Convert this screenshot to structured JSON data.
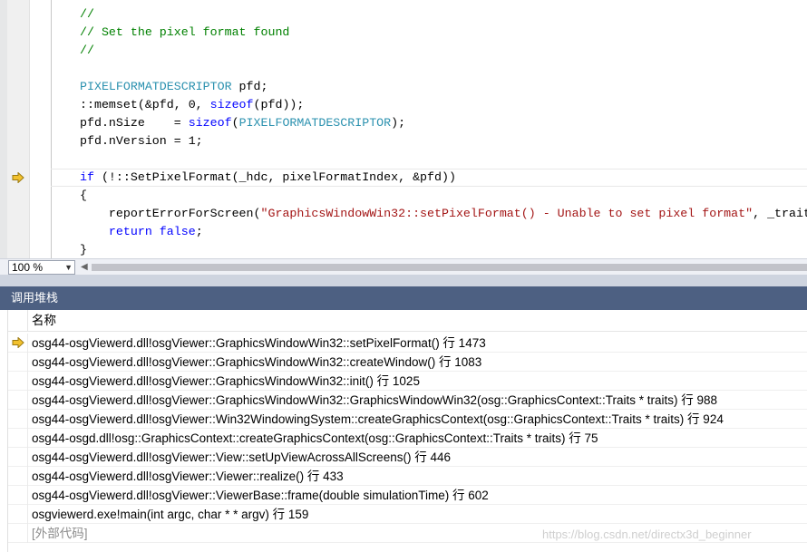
{
  "editor": {
    "lines": [
      [
        {
          "t": "//",
          "c": "cm"
        }
      ],
      [
        {
          "t": "// Set the pixel format found",
          "c": "cm"
        }
      ],
      [
        {
          "t": "//",
          "c": "cm"
        }
      ],
      [],
      [
        {
          "t": "PIXELFORMATDESCRIPTOR",
          "c": "ty"
        },
        {
          "t": " pfd;",
          "c": ""
        }
      ],
      [
        {
          "t": "::memset(&pfd, 0, ",
          "c": ""
        },
        {
          "t": "sizeof",
          "c": "kw"
        },
        {
          "t": "(pfd));",
          "c": ""
        }
      ],
      [
        {
          "t": "pfd.nSize    = ",
          "c": ""
        },
        {
          "t": "sizeof",
          "c": "kw"
        },
        {
          "t": "(",
          "c": ""
        },
        {
          "t": "PIXELFORMATDESCRIPTOR",
          "c": "ty"
        },
        {
          "t": ");",
          "c": ""
        }
      ],
      [
        {
          "t": "pfd.nVersion = 1;",
          "c": ""
        }
      ],
      [],
      [
        {
          "t": "if",
          "c": "kw"
        },
        {
          "t": " (!::SetPixelFormat(_hdc, pixelFormatIndex, &pfd))",
          "c": ""
        }
      ],
      [
        {
          "t": "{",
          "c": ""
        }
      ],
      [
        {
          "t": "    reportErrorForScreen(",
          "c": ""
        },
        {
          "t": "\"GraphicsWindowWin32::setPixelFormat() - Unable to set pixel format\"",
          "c": "str"
        },
        {
          "t": ", _traits.get(), ::GetLastError());",
          "c": ""
        }
      ],
      [
        {
          "t": "    ",
          "c": ""
        },
        {
          "t": "return",
          "c": "kw"
        },
        {
          "t": " ",
          "c": ""
        },
        {
          "t": "false",
          "c": "kw"
        },
        {
          "t": ";",
          "c": ""
        }
      ],
      [
        {
          "t": "}",
          "c": ""
        }
      ]
    ]
  },
  "zoom": {
    "value": "100 %"
  },
  "callstack": {
    "title": "调用堆栈",
    "column_name": "名称",
    "rows": [
      {
        "text": "osg44-osgViewerd.dll!osgViewer::GraphicsWindowWin32::setPixelFormat() 行 1473",
        "current": true
      },
      {
        "text": "osg44-osgViewerd.dll!osgViewer::GraphicsWindowWin32::createWindow() 行 1083",
        "current": false
      },
      {
        "text": "osg44-osgViewerd.dll!osgViewer::GraphicsWindowWin32::init() 行 1025",
        "current": false
      },
      {
        "text": "osg44-osgViewerd.dll!osgViewer::GraphicsWindowWin32::GraphicsWindowWin32(osg::GraphicsContext::Traits * traits) 行 988",
        "current": false
      },
      {
        "text": "osg44-osgViewerd.dll!osgViewer::Win32WindowingSystem::createGraphicsContext(osg::GraphicsContext::Traits * traits) 行 924",
        "current": false
      },
      {
        "text": "osg44-osgd.dll!osg::GraphicsContext::createGraphicsContext(osg::GraphicsContext::Traits * traits) 行 75",
        "current": false
      },
      {
        "text": "osg44-osgViewerd.dll!osgViewer::View::setUpViewAcrossAllScreens() 行 446",
        "current": false
      },
      {
        "text": "osg44-osgViewerd.dll!osgViewer::Viewer::realize() 行 433",
        "current": false
      },
      {
        "text": "osg44-osgViewerd.dll!osgViewer::ViewerBase::frame(double simulationTime) 行 602",
        "current": false
      },
      {
        "text": "osgviewerd.exe!main(int argc, char * * argv) 行 159",
        "current": false
      },
      {
        "text": "[外部代码]",
        "current": false,
        "external": true
      }
    ]
  },
  "watermark": "https://blog.csdn.net/directx3d_beginner",
  "colors": {
    "panel_title_bg": "#4d6082",
    "current_arrow": "#f2c12e",
    "comment": "#008000",
    "keyword": "#0000ff",
    "type": "#2b91af",
    "string": "#a31515"
  }
}
